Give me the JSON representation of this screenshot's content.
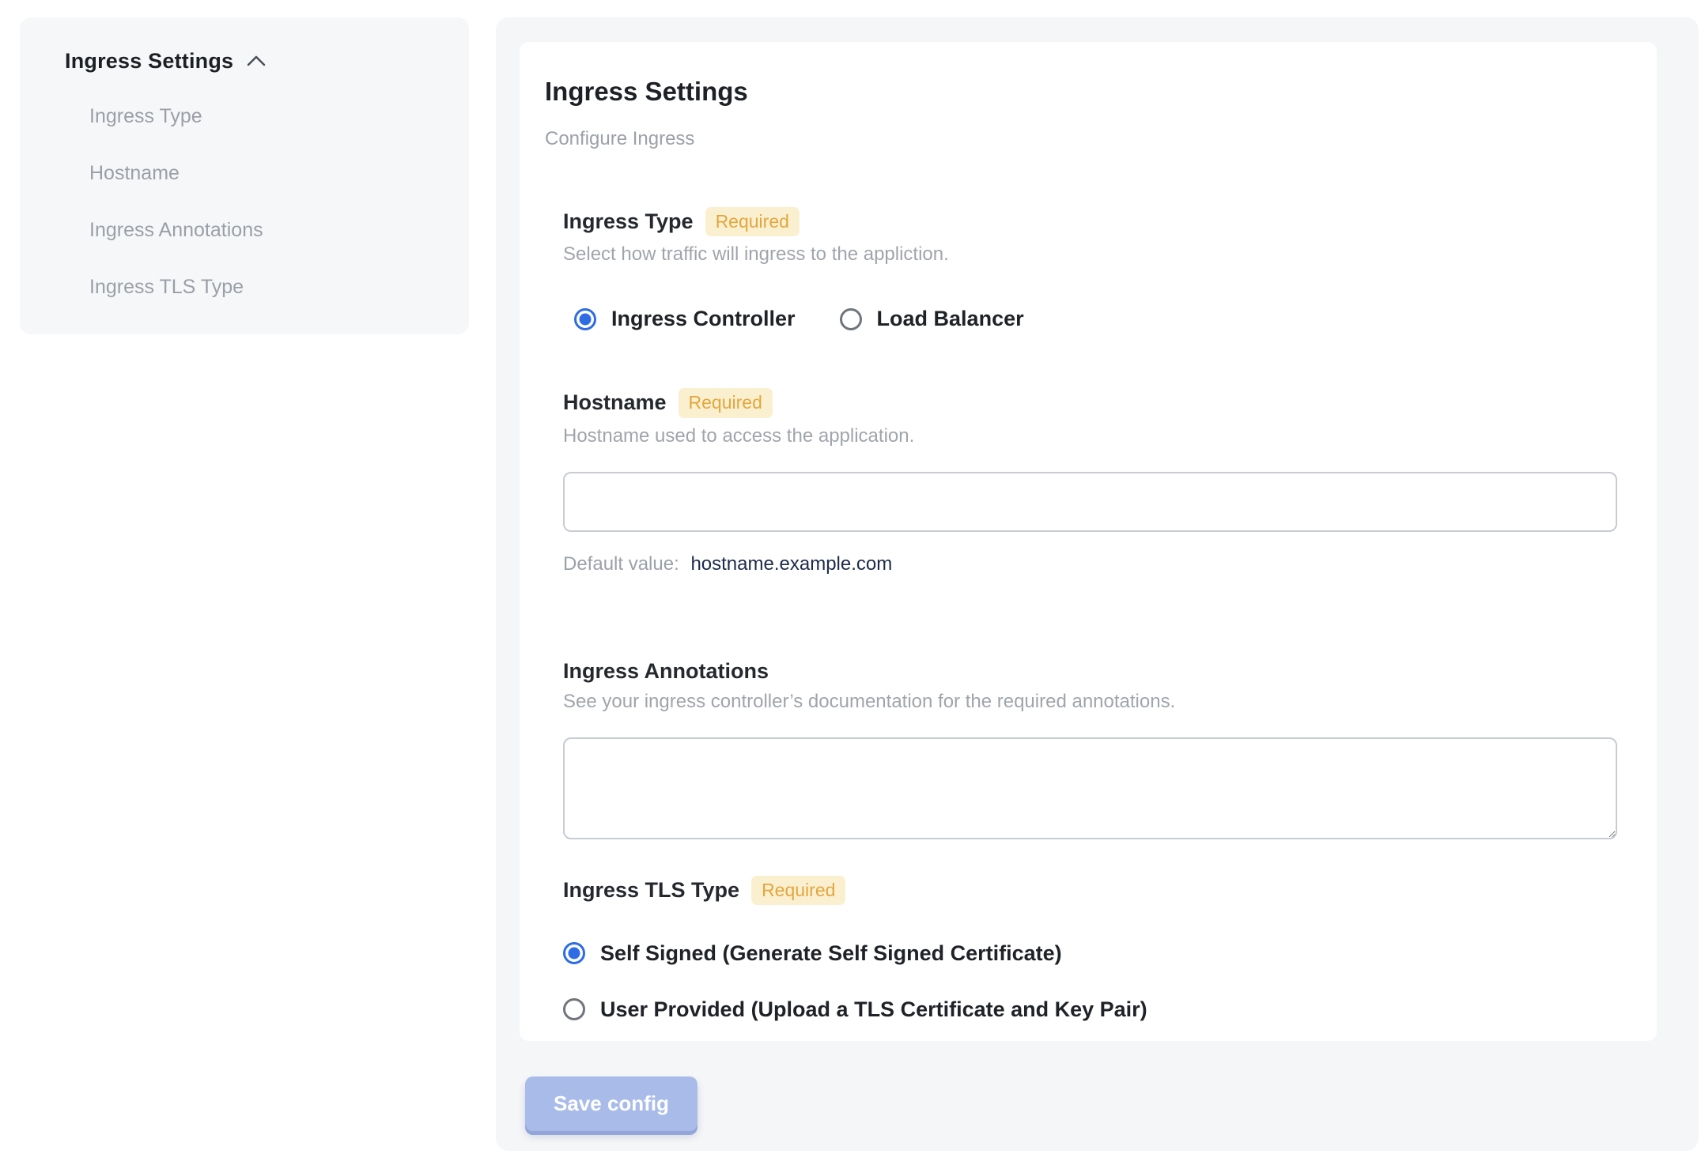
{
  "sidebar": {
    "header": "Ingress Settings",
    "items": [
      "Ingress Type",
      "Hostname",
      "Ingress Annotations",
      "Ingress TLS Type"
    ]
  },
  "main": {
    "title": "Ingress Settings",
    "subtitle": "Configure Ingress",
    "ingress_type": {
      "label": "Ingress Type",
      "required_badge": "Required",
      "help": "Select how traffic will ingress to the appliction.",
      "options": [
        "Ingress Controller",
        "Load Balancer"
      ],
      "selected_index": 0
    },
    "hostname": {
      "label": "Hostname",
      "required_badge": "Required",
      "help": "Hostname used to access the application.",
      "value": "",
      "default_prefix": "Default value:",
      "default_value": "hostname.example.com"
    },
    "annotations": {
      "label": "Ingress Annotations",
      "help": "See your ingress controller’s documentation for the required annotations.",
      "value": ""
    },
    "tls": {
      "label": "Ingress TLS Type",
      "required_badge": "Required",
      "options": [
        "Self Signed (Generate Self Signed Certificate)",
        "User Provided (Upload a TLS Certificate and Key Pair)"
      ],
      "selected_index": 0
    }
  },
  "footer": {
    "save_label": "Save config"
  },
  "colors": {
    "accent_blue": "#2e6ce4",
    "badge_bg": "#faf0d0",
    "badge_text": "#e3a63e",
    "panel_bg": "#f5f6f8",
    "sidebar_bg": "#f6f7f9",
    "disabled_button_bg": "#a9bce9",
    "default_value_text": "#1c2b4a"
  }
}
